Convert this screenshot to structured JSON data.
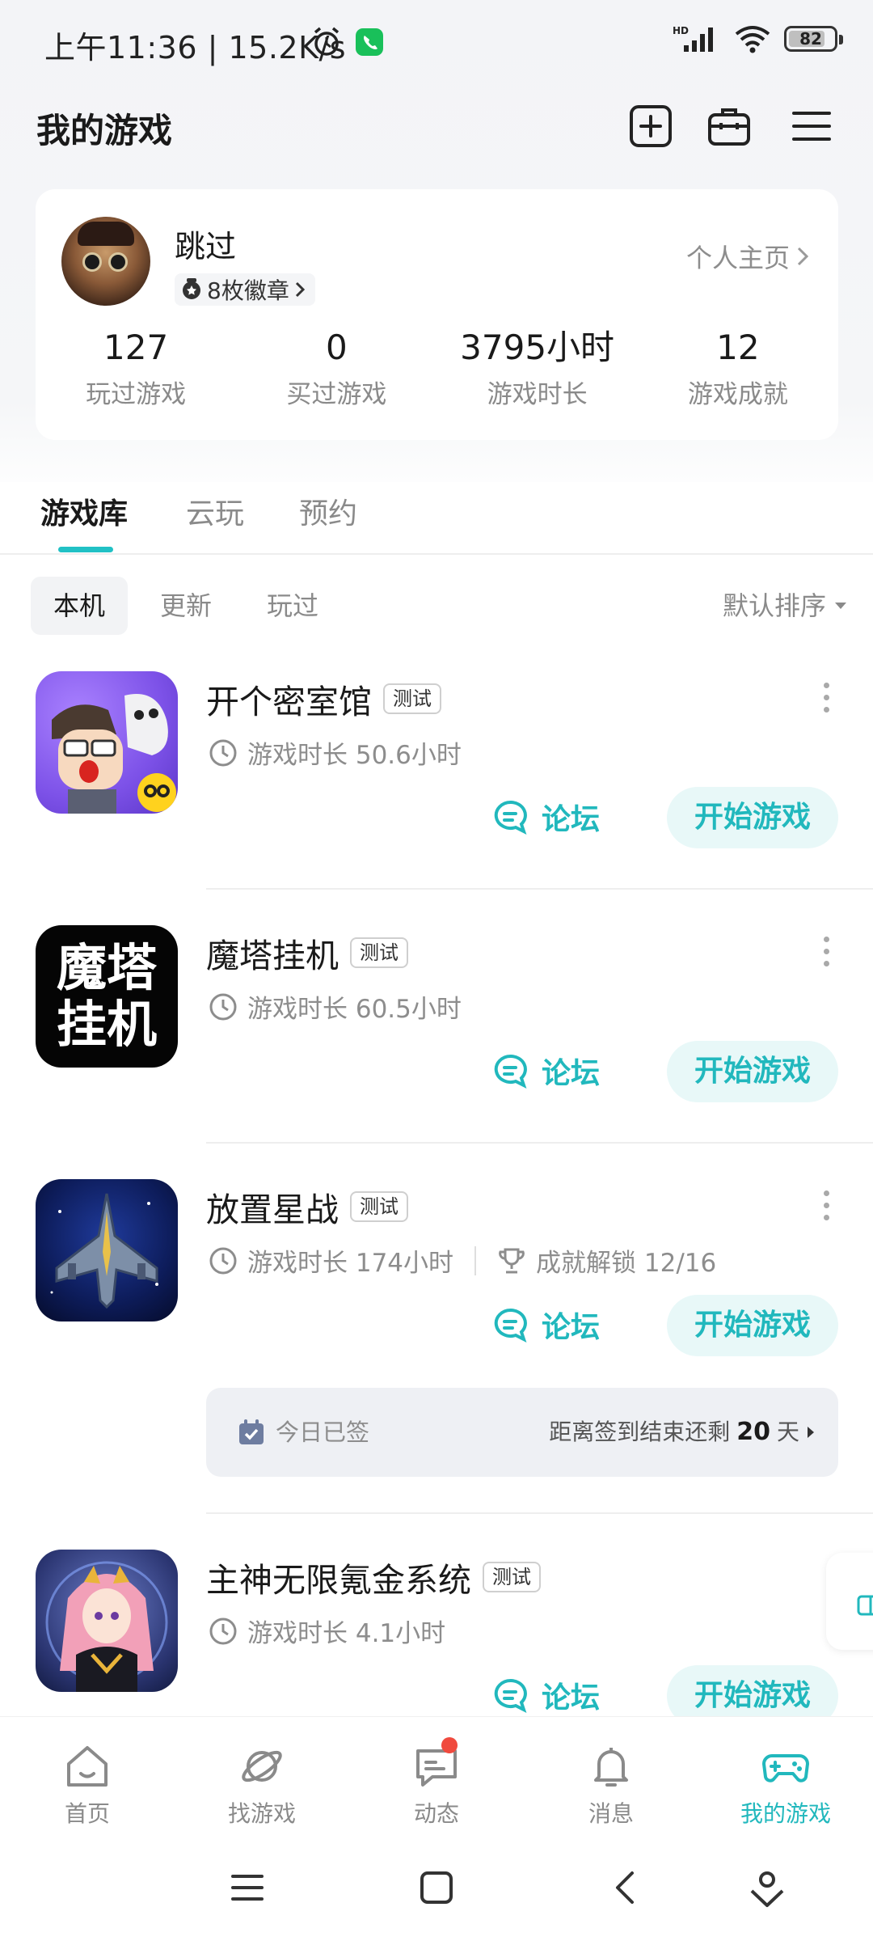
{
  "status_bar": {
    "time": "上午11:36 | 15.2K/s",
    "network": "HD",
    "battery": "82",
    "battery_level": 0.82
  },
  "header": {
    "title": "我的游戏"
  },
  "profile": {
    "nickname": "跳过",
    "badges": "8枚徽章",
    "profile_link": "个人主页",
    "stats": [
      {
        "value": "127",
        "label": "玩过游戏"
      },
      {
        "value": "0",
        "label": "买过游戏"
      },
      {
        "value": "3795小时",
        "label": "游戏时长"
      },
      {
        "value": "12",
        "label": "游戏成就"
      }
    ]
  },
  "tabs": [
    "游戏库",
    "云玩",
    "预约"
  ],
  "filters": [
    "本机",
    "更新",
    "玩过"
  ],
  "sort_label": "默认排序",
  "games": [
    {
      "name": "开个密室馆",
      "tag": "测试",
      "playtime": "游戏时长 50.6小时",
      "forum": "论坛",
      "start": "开始游戏"
    },
    {
      "name": "魔塔挂机",
      "tag": "测试",
      "playtime": "游戏时长 60.5小时",
      "forum": "论坛",
      "start": "开始游戏",
      "icon_text": "魔塔\n挂机"
    },
    {
      "name": "放置星战",
      "tag": "测试",
      "playtime": "游戏时长 174小时",
      "achievement": "成就解锁 12/16",
      "forum": "论坛",
      "start": "开始游戏"
    },
    {
      "name": "主神无限氪金系统",
      "tag": "测试",
      "playtime": "游戏时长 4.1小时",
      "forum": "论坛",
      "start": "开始游戏"
    }
  ],
  "signin": {
    "status": "今日已签",
    "remaining_prefix": "距离签到结束还剩",
    "remaining_days": "20",
    "remaining_unit": "天"
  },
  "bottom_nav": [
    {
      "label": "首页",
      "icon": "home-icon"
    },
    {
      "label": "找游戏",
      "icon": "planet-icon"
    },
    {
      "label": "动态",
      "icon": "chat-icon"
    },
    {
      "label": "消息",
      "icon": "bell-icon"
    },
    {
      "label": "我的游戏",
      "icon": "gamepad-icon"
    }
  ],
  "colors": {
    "accent": "#21b8bd",
    "accent_bg": "#e8f8f8",
    "notification": "#f04a3e"
  }
}
